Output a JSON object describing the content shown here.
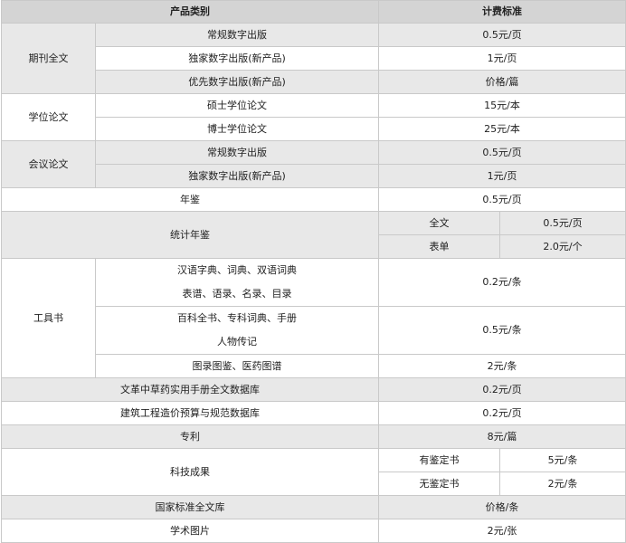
{
  "header": {
    "category": "产品类别",
    "pricing": "计费标准"
  },
  "journal": {
    "label": "期刊全文",
    "rows": [
      {
        "name": "常规数字出版",
        "price": "0.5元/页"
      },
      {
        "name": "独家数字出版(新产品)",
        "price": "1元/页"
      },
      {
        "name": "优先数字出版(新产品)",
        "price": "价格/篇"
      }
    ]
  },
  "thesis": {
    "label": "学位论文",
    "rows": [
      {
        "name": "硕士学位论文",
        "price": "15元/本"
      },
      {
        "name": "博士学位论文",
        "price": "25元/本"
      }
    ]
  },
  "conference": {
    "label": "会议论文",
    "rows": [
      {
        "name": "常规数字出版",
        "price": "0.5元/页"
      },
      {
        "name": "独家数字出版(新产品)",
        "price": "1元/页"
      }
    ]
  },
  "yearbook": {
    "label": "年鉴",
    "price": "0.5元/页"
  },
  "stat_yearbook": {
    "label": "统计年鉴",
    "rows": [
      {
        "name": "全文",
        "price": "0.5元/页"
      },
      {
        "name": "表单",
        "price": "2.0元/个"
      }
    ]
  },
  "reference": {
    "label": "工具书",
    "rows": [
      {
        "line1": "汉语字典、词典、双语词典",
        "line2": "表谱、语录、名录、目录",
        "price": "0.2元/条"
      },
      {
        "line1": "百科全书、专科词典、手册",
        "line2": "人物传记",
        "price": "0.5元/条"
      },
      {
        "line1": "图录图鉴、医药图谱",
        "price": "2元/条"
      }
    ]
  },
  "herbal_db": {
    "label": "文革中草药实用手册全文数据库",
    "price": "0.2元/页"
  },
  "construction_db": {
    "label": "建筑工程造价预算与规范数据库",
    "price": "0.2元/页"
  },
  "patent": {
    "label": "专利",
    "price": "8元/篇"
  },
  "tech_achievements": {
    "label": "科技成果",
    "rows": [
      {
        "name": "有鉴定书",
        "price": "5元/条"
      },
      {
        "name": "无鉴定书",
        "price": "2元/条"
      }
    ]
  },
  "standards_db": {
    "label": "国家标准全文库",
    "price": "价格/条"
  },
  "academic_images": {
    "label": "学术图片",
    "price": "2元/张"
  }
}
